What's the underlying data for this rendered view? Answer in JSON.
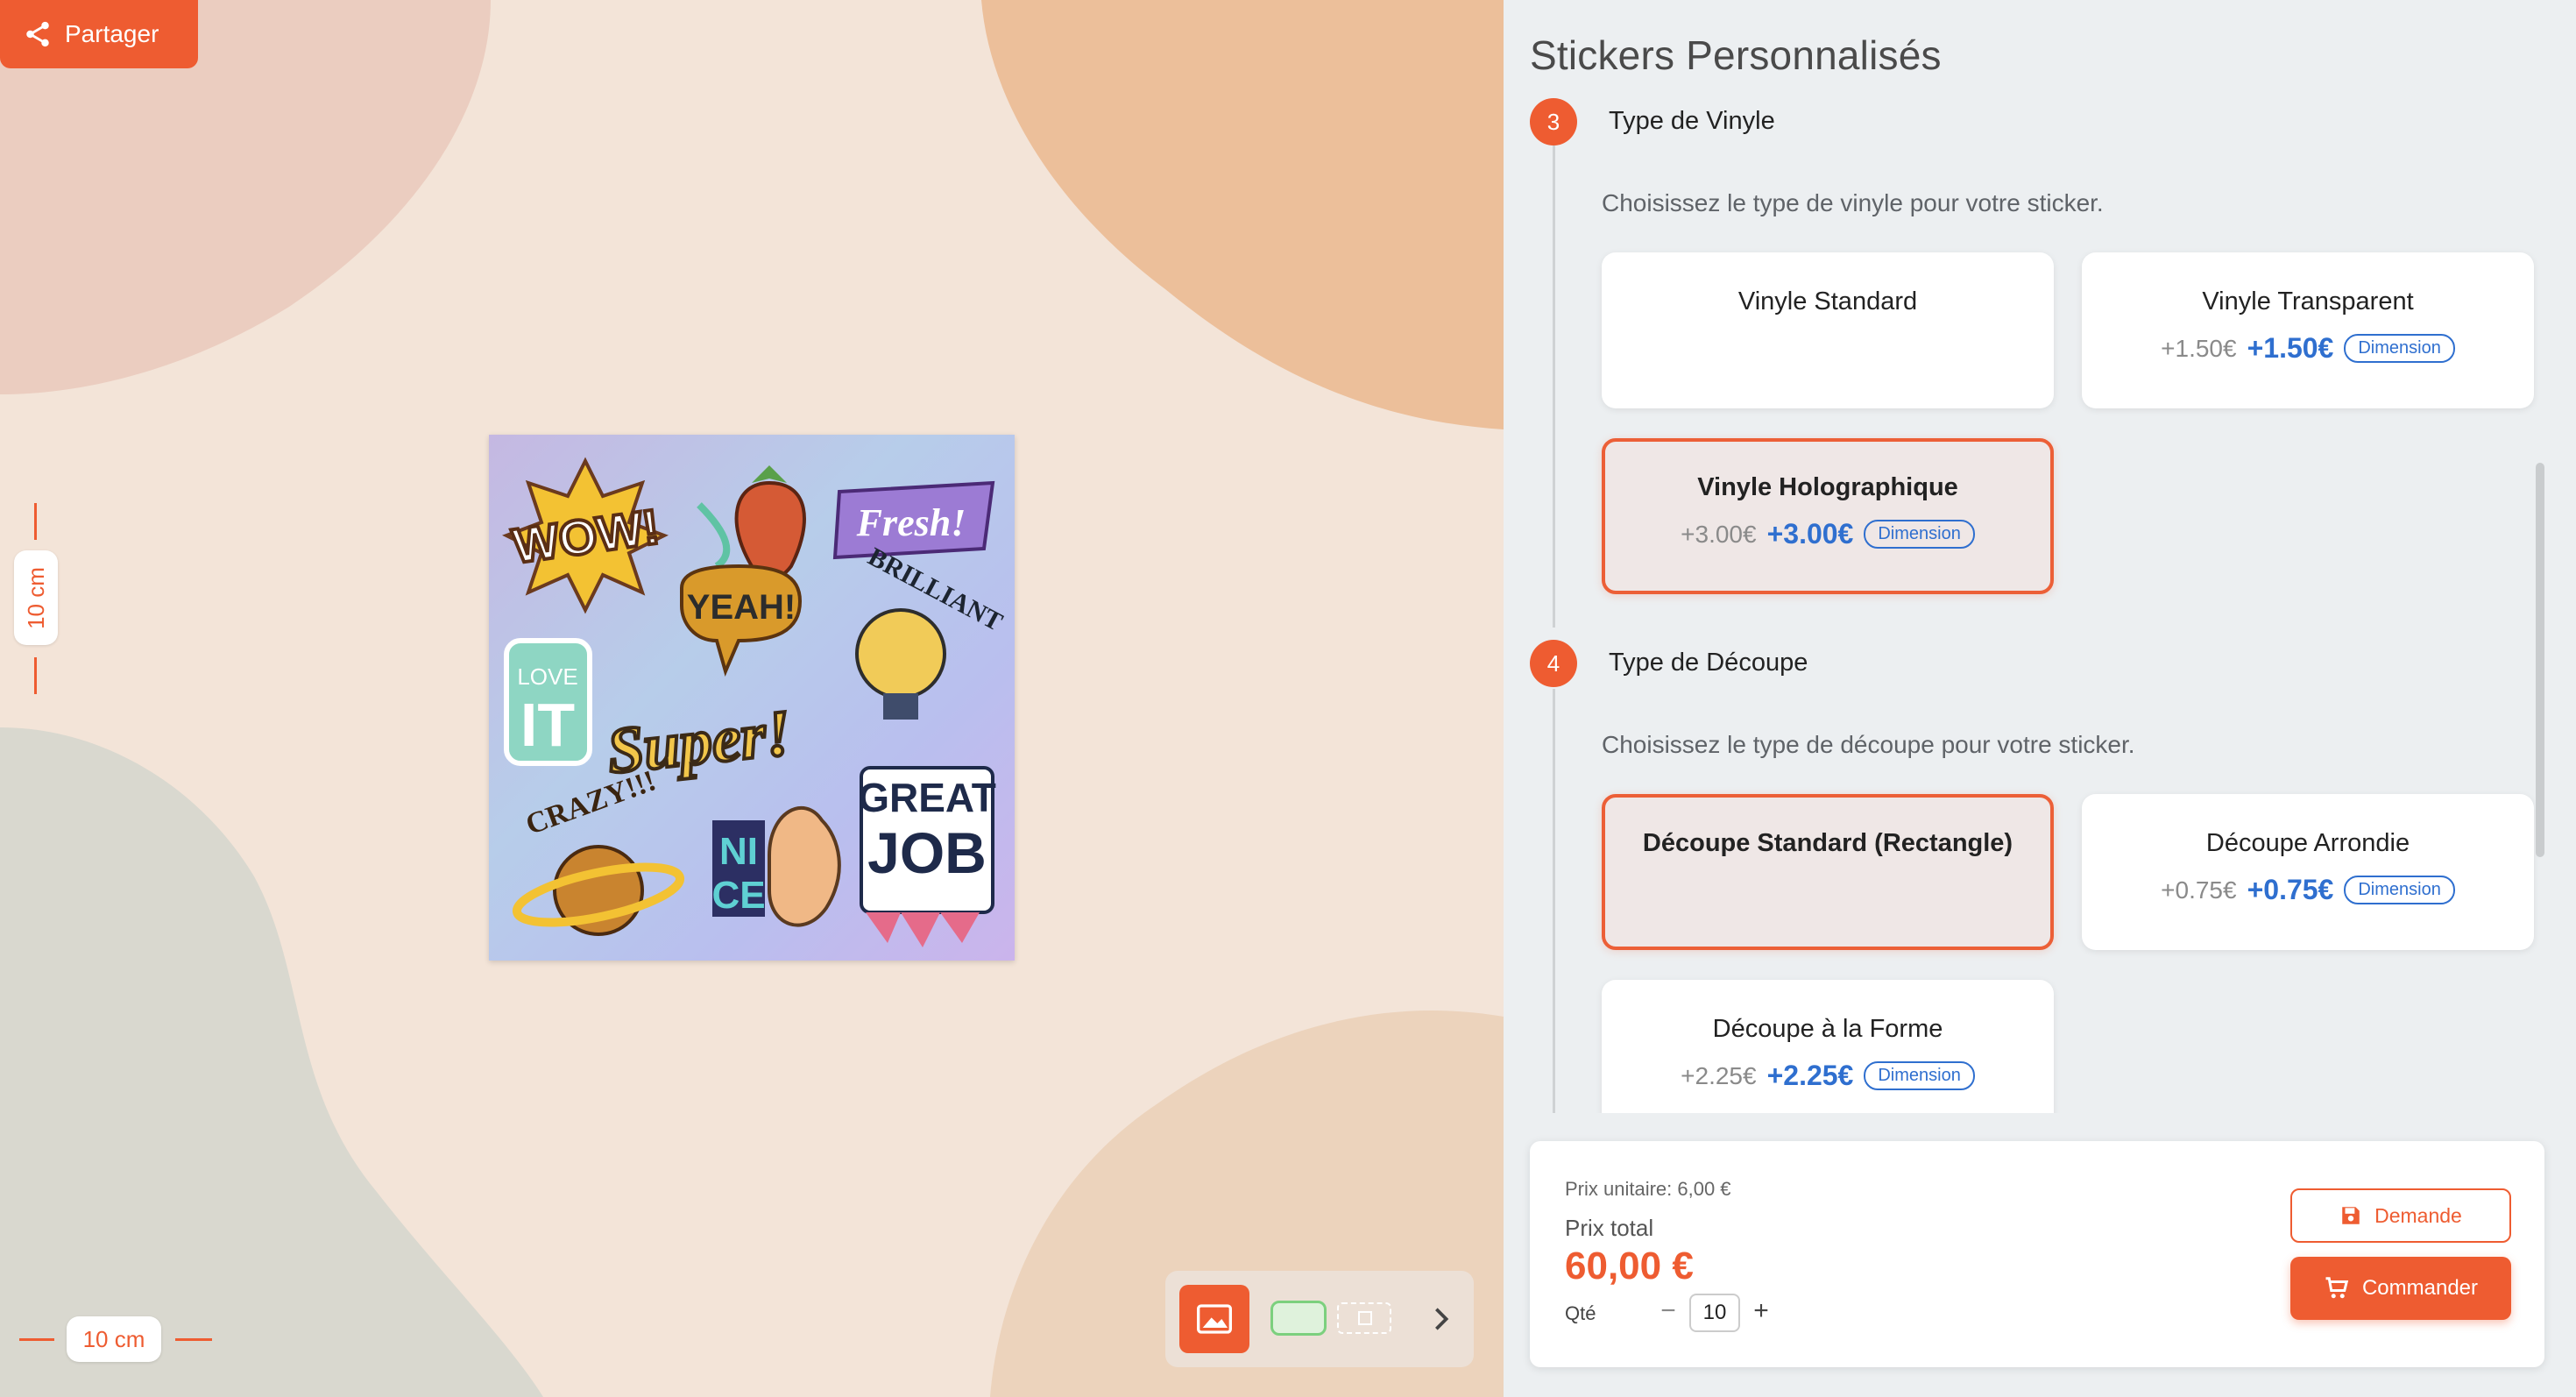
{
  "toolbar": {
    "share_label": "Partager"
  },
  "canvas": {
    "height_dimension": "10 cm",
    "width_dimension": "10 cm",
    "stickers": [
      "WOW!",
      "Fresh!",
      "YEAH!",
      "BRILLIANT",
      "LOVE",
      "IT",
      "Super!",
      "CRAZY!!!",
      "NI",
      "CE",
      "GREAT",
      "JOB"
    ]
  },
  "panel": {
    "title": "Stickers Personnalisés",
    "steps": [
      {
        "number": "3",
        "title": "Type de Vinyle",
        "description": "Choisissez le type de vinyle pour votre sticker.",
        "options": [
          {
            "name": "Vinyle Standard",
            "selected": false
          },
          {
            "name": "Vinyle Transparent",
            "old_price": "+1.50€",
            "new_price": "+1.50€",
            "tag": "Dimension",
            "selected": false
          },
          {
            "name": "Vinyle Holographique",
            "old_price": "+3.00€",
            "new_price": "+3.00€",
            "tag": "Dimension",
            "selected": true
          }
        ]
      },
      {
        "number": "4",
        "title": "Type de Découpe",
        "description": "Choisissez le type de découpe pour votre sticker.",
        "options": [
          {
            "name": "Découpe Standard (Rectangle)",
            "selected": true
          },
          {
            "name": "Découpe Arrondie",
            "old_price": "+0.75€",
            "new_price": "+0.75€",
            "tag": "Dimension",
            "selected": false
          },
          {
            "name": "Découpe à la Forme",
            "old_price": "+2.25€",
            "new_price": "+2.25€",
            "tag": "Dimension",
            "selected": false
          }
        ]
      }
    ]
  },
  "order": {
    "unit_price": "Prix unitaire: 6,00 €",
    "total_label": "Prix total",
    "total_value": "60,00 €",
    "qty_label": "Qté",
    "qty_minus": "−",
    "qty_value": "10",
    "qty_plus": "+",
    "request_label": "Demande",
    "order_label": "Commander"
  },
  "colors": {
    "accent": "#ee5c31",
    "price_blue": "#2f6fcf",
    "selected_bg": "#efe7e6"
  },
  "icons": {
    "share": "share-icon",
    "image": "image-icon",
    "save": "save-icon",
    "cart": "cart-icon",
    "next": "chevron-right-icon"
  }
}
